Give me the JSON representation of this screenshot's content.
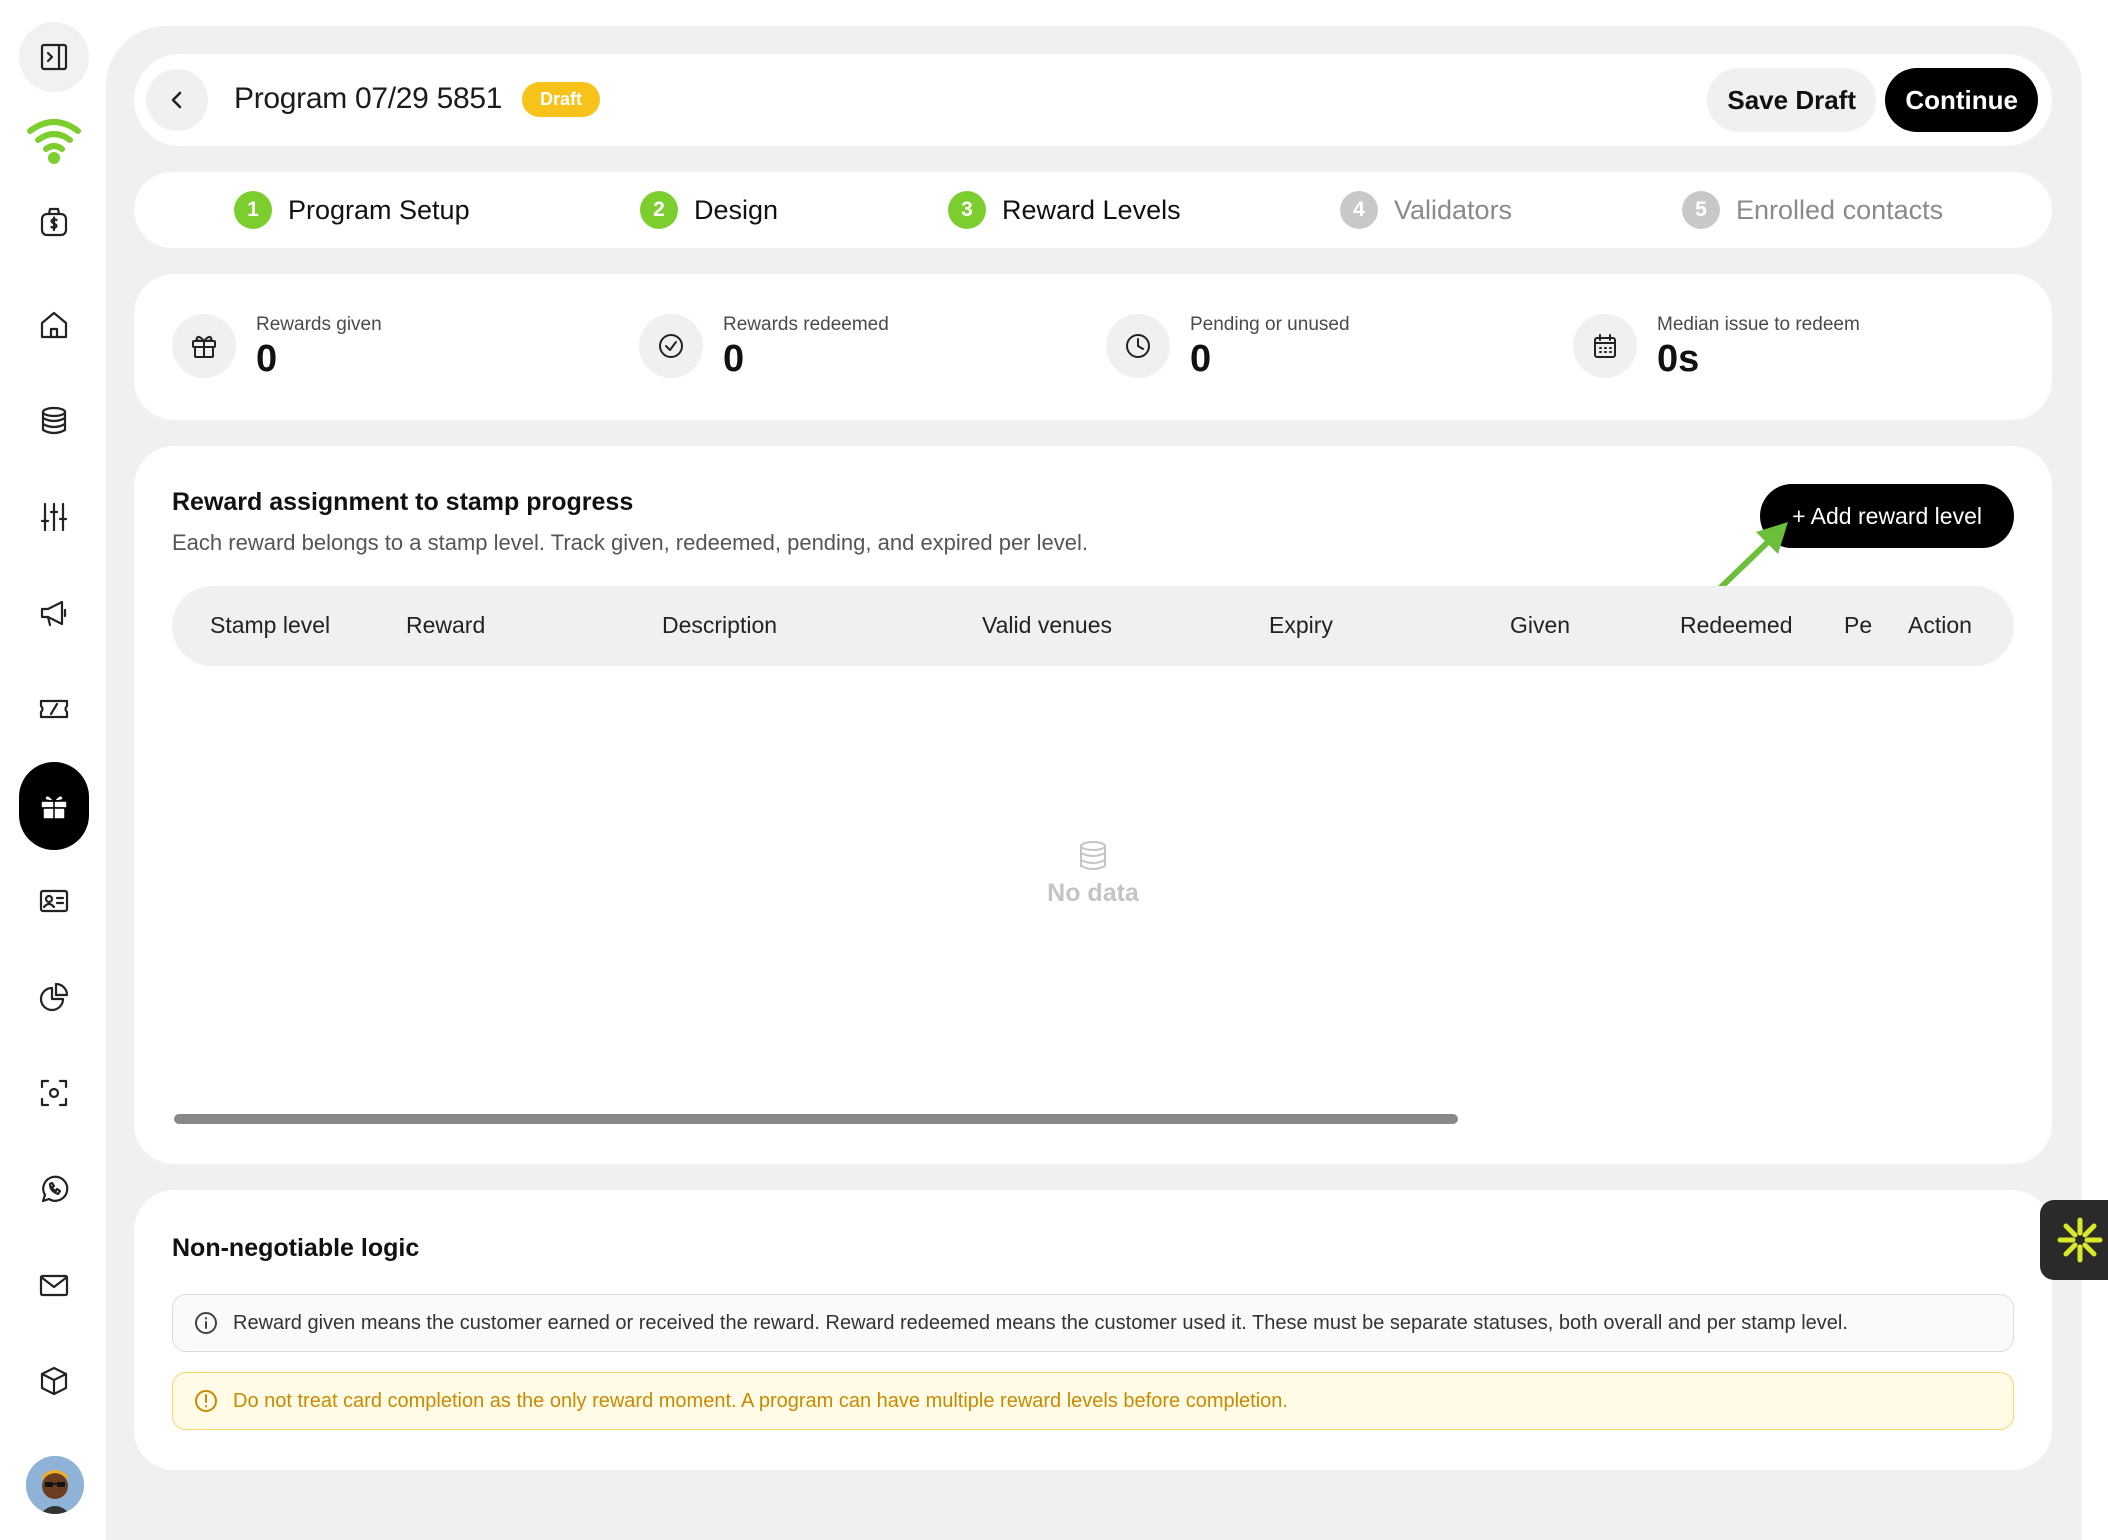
{
  "header": {
    "title": "Program 07/29 5851",
    "status_badge": "Draft",
    "save_draft_label": "Save Draft",
    "continue_label": "Continue"
  },
  "steps": [
    {
      "number": "1",
      "label": "Program Setup",
      "state": "done"
    },
    {
      "number": "2",
      "label": "Design",
      "state": "done"
    },
    {
      "number": "3",
      "label": "Reward Levels",
      "state": "done"
    },
    {
      "number": "4",
      "label": "Validators",
      "state": "todo"
    },
    {
      "number": "5",
      "label": "Enrolled contacts",
      "state": "todo"
    }
  ],
  "stats": [
    {
      "label": "Rewards given",
      "value": "0",
      "icon": "gift-icon"
    },
    {
      "label": "Rewards redeemed",
      "value": "0",
      "icon": "check-circle-icon"
    },
    {
      "label": "Pending or unused",
      "value": "0",
      "icon": "clock-icon"
    },
    {
      "label": "Median issue to redeem",
      "value": "0s",
      "icon": "calendar-icon"
    }
  ],
  "reward_table": {
    "title": "Reward assignment to stamp progress",
    "subtitle": "Each reward belongs to a stamp level. Track given, redeemed, pending, and expired per level.",
    "add_button_label": "+ Add reward level",
    "columns": [
      "Stamp level",
      "Reward",
      "Description",
      "Valid venues",
      "Expiry",
      "Given",
      "Redeemed",
      "Pe",
      "Action"
    ],
    "empty_text": "No data"
  },
  "logic": {
    "title": "Non-negotiable logic",
    "info_note": "Reward given means the customer earned or received the reward. Reward redeemed means the customer used it. These must be separate statuses, both overall and per stamp level.",
    "warn_note": "Do not treat card completion as the only reward moment. A program can have multiple reward levels before completion."
  },
  "colors": {
    "accent_green": "#7ccd2e",
    "draft_badge": "#f7c21a",
    "primary_button": "#000000",
    "warning_text": "#c98a00"
  }
}
